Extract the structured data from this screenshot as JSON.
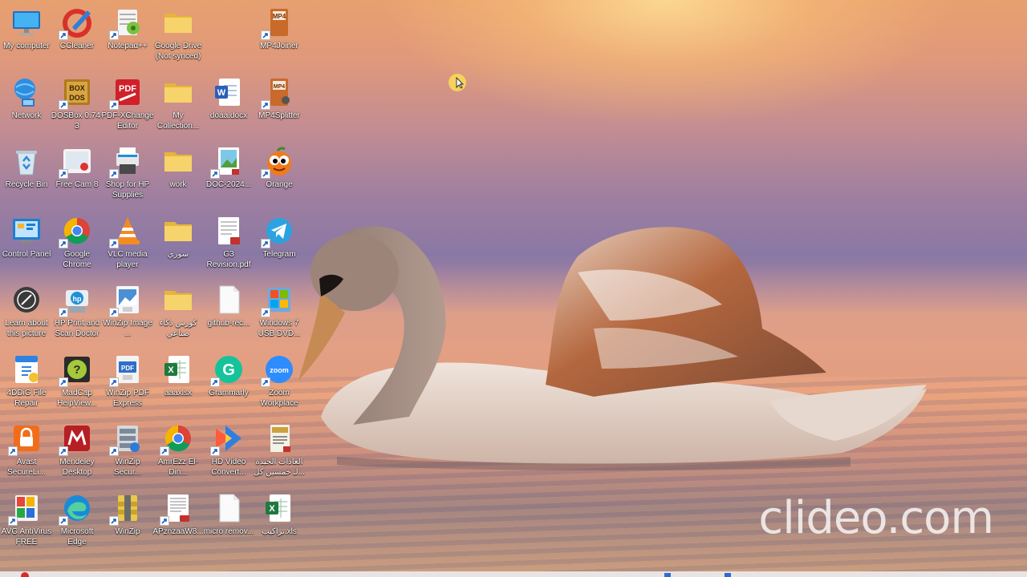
{
  "desktop": {
    "watermark": "clideo.com",
    "icons": [
      {
        "label": "My computer",
        "icon": "monitor-icon"
      },
      {
        "label": "CCleaner",
        "icon": "ccleaner-icon"
      },
      {
        "label": "Notepad++",
        "icon": "notepadpp-icon"
      },
      {
        "label": "Google Drive (Not synced)",
        "icon": "folder-icon"
      },
      {
        "label": "MP4Joiner",
        "icon": "mp4joiner-icon"
      },
      {
        "label": "Network",
        "icon": "network-icon"
      },
      {
        "label": "DOSBox 0.74-3",
        "icon": "dosbox-icon"
      },
      {
        "label": "PDF-XChange Editor",
        "icon": "pdf-xchange-icon"
      },
      {
        "label": "My Collection...",
        "icon": "folder-icon"
      },
      {
        "label": "doaa.docx",
        "icon": "word-doc-icon"
      },
      {
        "label": "MP4Splitter",
        "icon": "mp4splitter-icon"
      },
      {
        "label": "Recycle Bin",
        "icon": "recycle-bin-icon"
      },
      {
        "label": "Free Cam 8",
        "icon": "freecam-icon"
      },
      {
        "label": "Shop for HP Supplies",
        "icon": "hp-supplies-icon"
      },
      {
        "label": "work",
        "icon": "folder-icon"
      },
      {
        "label": "DOC-2024...",
        "icon": "doc-image-icon"
      },
      {
        "label": "Orange",
        "icon": "orange-icon"
      },
      {
        "label": "Control Panel",
        "icon": "control-panel-icon"
      },
      {
        "label": "Google Chrome",
        "icon": "chrome-icon"
      },
      {
        "label": "VLC media player",
        "icon": "vlc-icon"
      },
      {
        "label": "سوري",
        "icon": "folder-icon"
      },
      {
        "label": "G3 Revision.pdf",
        "icon": "pdf-file-icon"
      },
      {
        "label": "Telegram",
        "icon": "telegram-icon"
      },
      {
        "label": "Learn about this picture",
        "icon": "learn-picture-icon"
      },
      {
        "label": "HP Print and Scan Doctor",
        "icon": "hp-doctor-icon"
      },
      {
        "label": "WinZip Image ...",
        "icon": "winzip-image-icon"
      },
      {
        "label": "كورس ذكاء صناعي",
        "icon": "folder-icon"
      },
      {
        "label": "github-rec...",
        "icon": "blank-file-icon"
      },
      {
        "label": "Windows 7 USB DVD...",
        "icon": "win7-usb-icon"
      },
      {
        "label": "4DDiG File Repair",
        "icon": "4ddig-icon"
      },
      {
        "label": "MadCap HelpView...",
        "icon": "madcap-icon"
      },
      {
        "label": "WinZip PDF Express",
        "icon": "winzip-pdf-icon"
      },
      {
        "label": "aaaxlsx",
        "icon": "excel-file-icon"
      },
      {
        "label": "Grammarly",
        "icon": "grammarly-icon"
      },
      {
        "label": "Zoom Workplace",
        "icon": "zoom-icon"
      },
      {
        "label": "Avast SecureLi...",
        "icon": "avast-secureline-icon"
      },
      {
        "label": "Mendeley Desktop",
        "icon": "mendeley-icon"
      },
      {
        "label": "WinZip Secur...",
        "icon": "winzip-secure-icon"
      },
      {
        "label": "AmrEzz El-Din...",
        "icon": "chrome-icon"
      },
      {
        "label": "HD Video Convert...",
        "icon": "hd-video-icon"
      },
      {
        "label": "العادات الجيدة لـ خمسين كل...",
        "icon": "book-pdf-icon"
      },
      {
        "label": "AVG AntiVirus FREE",
        "icon": "avg-icon"
      },
      {
        "label": "Microsoft Edge",
        "icon": "edge-icon"
      },
      {
        "label": "WinZip",
        "icon": "winzip-icon"
      },
      {
        "label": "APznzaaW8...",
        "icon": "document-thumb-icon"
      },
      {
        "label": "micro remov...",
        "icon": "blank-file-icon"
      },
      {
        "label": "تراكيب.xls",
        "icon": "excel-file-icon"
      }
    ]
  }
}
